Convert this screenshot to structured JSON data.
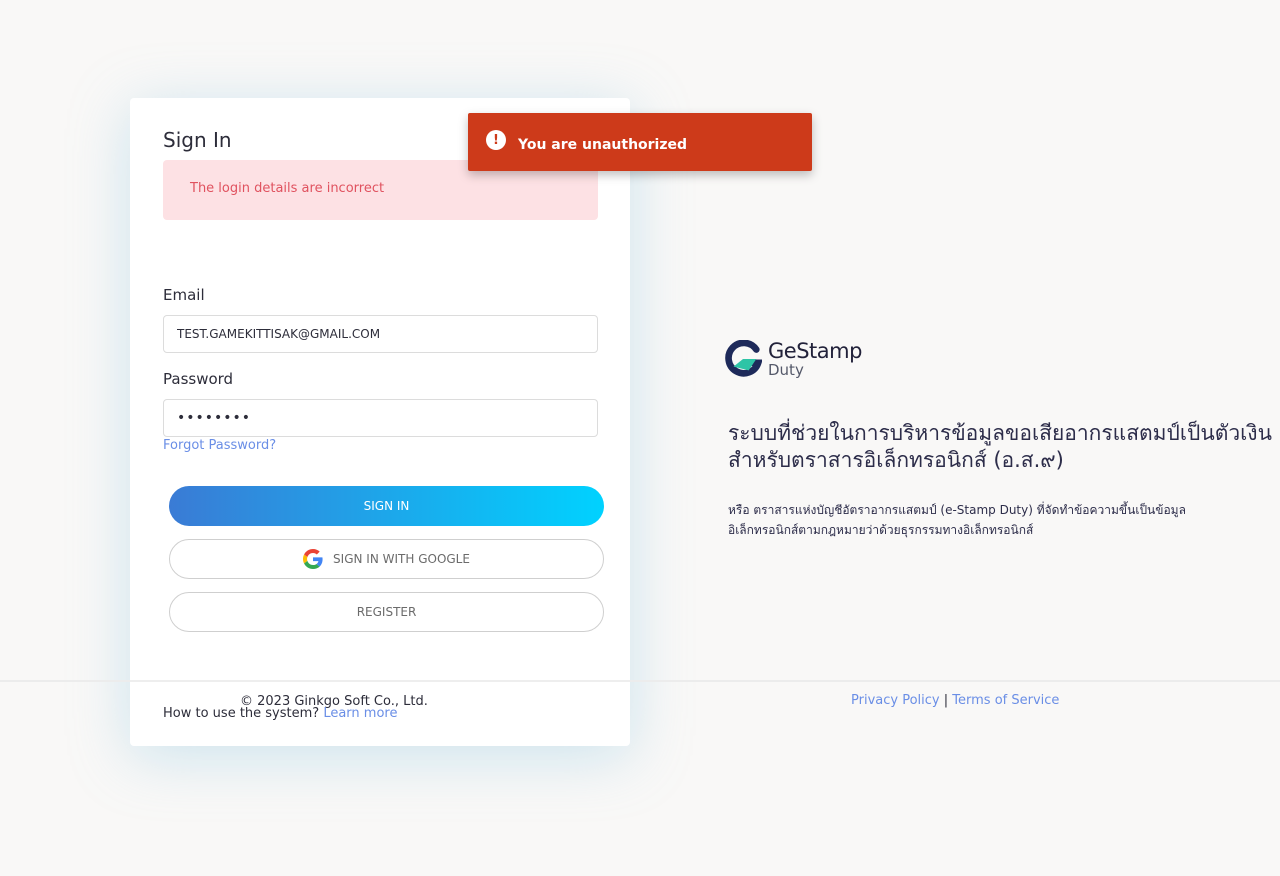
{
  "login": {
    "title": "Sign In",
    "error_message": "The login details are incorrect",
    "email_label": "Email",
    "email_value": "TEST.GAMEKITTISAK@GMAIL.COM",
    "password_label": "Password",
    "password_value": "••••••••",
    "forgot_password": "Forgot Password?",
    "sign_in_button": "SIGN IN",
    "google_button": "SIGN IN WITH GOOGLE",
    "register_button": "REGISTER",
    "copyright": "© 2023 Ginkgo Soft Co., Ltd.",
    "how_to_prefix": "How to use the system?",
    "learn_more": "Learn more"
  },
  "toast": {
    "message": "You are unauthorized",
    "color": "#cd3a1a"
  },
  "brand": {
    "name": "GeStamp",
    "sub": "Duty",
    "heading": "ระบบที่ช่วยในการบริหารข้อมูลขอเสียอากรแสตมป์เป็นตัวเงินสำหรับตราสารอิเล็กทรอนิกส์ (อ.ส.๙)",
    "description": "หรือ ตราสารแห่งบัญชีอัตราอากรแสตมป์ (e-Stamp Duty) ที่จัดทำข้อความขึ้นเป็นข้อมูลอิเล็กทรอนิกส์ตามกฎหมายว่าด้วยธุรกรรมทางอิเล็กทรอนิกส์"
  },
  "footer": {
    "privacy": "Privacy Policy",
    "separator": "|",
    "terms": "Terms of Service"
  },
  "colors": {
    "primary_gradient_start": "#3a7bd5",
    "primary_gradient_end": "#00d2ff",
    "link": "#6a8ee6",
    "alert_bg": "#fde1e4",
    "alert_text": "#e0525f"
  },
  "icons": {
    "toast": "exclamation-circle-icon",
    "google": "google-g-icon",
    "logo": "gestamp-logo-icon"
  }
}
